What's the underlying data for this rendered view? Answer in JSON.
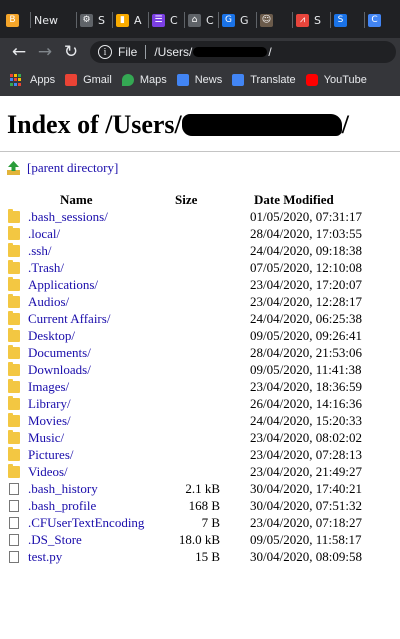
{
  "browser": {
    "tabs": [
      {
        "letter": "B",
        "label": "",
        "color": "#f4a52a"
      },
      {
        "letter": "",
        "label": "New",
        "color": "#202124"
      },
      {
        "letter": "⚙",
        "label": "S",
        "color": "#5f6368"
      },
      {
        "letter": "▮",
        "label": "A",
        "color": "#f9ab00"
      },
      {
        "letter": "☰",
        "label": "C",
        "color": "#7b3fe4"
      },
      {
        "letter": "⌂",
        "label": "C",
        "color": "#5f6368"
      },
      {
        "letter": "G",
        "label": "G",
        "color": "#1a73e8"
      },
      {
        "letter": "☺",
        "label": "",
        "color": "#6b5b4b"
      },
      {
        "letter": "⩘",
        "label": "S",
        "color": "#e8453c"
      },
      {
        "letter": "S",
        "label": "",
        "color": "#1a73e8"
      },
      {
        "letter": "C",
        "label": "",
        "color": "#4285f4"
      }
    ],
    "address": {
      "scheme": "File",
      "path_prefix": "/Users/",
      "path_suffix": "/"
    },
    "bookmarks": [
      {
        "label": "Apps",
        "icon": "apps-grid-icon"
      },
      {
        "label": "Gmail",
        "icon": "gmail-icon",
        "color": "#ea4335"
      },
      {
        "label": "Maps",
        "icon": "maps-icon",
        "color": "#34a853"
      },
      {
        "label": "News",
        "icon": "news-icon",
        "color": "#4285f4"
      },
      {
        "label": "Translate",
        "icon": "translate-icon",
        "color": "#4285f4"
      },
      {
        "label": "YouTube",
        "icon": "youtube-icon",
        "color": "#ff0000"
      }
    ]
  },
  "page": {
    "title_prefix": "Index of /Users/",
    "title_suffix": "/",
    "parent_link": "[parent directory]",
    "columns": {
      "name": "Name",
      "size": "Size",
      "date": "Date Modified"
    },
    "entries": [
      {
        "name": ".bash_sessions/",
        "size": "",
        "date": "01/05/2020, 07:31:17",
        "type": "folder"
      },
      {
        "name": ".local/",
        "size": "",
        "date": "28/04/2020, 17:03:55",
        "type": "folder"
      },
      {
        "name": ".ssh/",
        "size": "",
        "date": "24/04/2020, 09:18:38",
        "type": "folder"
      },
      {
        "name": ".Trash/",
        "size": "",
        "date": "07/05/2020, 12:10:08",
        "type": "folder"
      },
      {
        "name": "Applications/",
        "size": "",
        "date": "23/04/2020, 17:20:07",
        "type": "folder"
      },
      {
        "name": "Audios/",
        "size": "",
        "date": "23/04/2020, 12:28:17",
        "type": "folder"
      },
      {
        "name": "Current Affairs/",
        "size": "",
        "date": "24/04/2020, 06:25:38",
        "type": "folder"
      },
      {
        "name": "Desktop/",
        "size": "",
        "date": "09/05/2020, 09:26:41",
        "type": "folder"
      },
      {
        "name": "Documents/",
        "size": "",
        "date": "28/04/2020, 21:53:06",
        "type": "folder"
      },
      {
        "name": "Downloads/",
        "size": "",
        "date": "09/05/2020, 11:41:38",
        "type": "folder"
      },
      {
        "name": "Images/",
        "size": "",
        "date": "23/04/2020, 18:36:59",
        "type": "folder"
      },
      {
        "name": "Library/",
        "size": "",
        "date": "26/04/2020, 14:16:36",
        "type": "folder"
      },
      {
        "name": "Movies/",
        "size": "",
        "date": "24/04/2020, 15:20:33",
        "type": "folder"
      },
      {
        "name": "Music/",
        "size": "",
        "date": "23/04/2020, 08:02:02",
        "type": "folder"
      },
      {
        "name": "Pictures/",
        "size": "",
        "date": "23/04/2020, 07:28:13",
        "type": "folder"
      },
      {
        "name": "Videos/",
        "size": "",
        "date": "23/04/2020, 21:49:27",
        "type": "folder"
      },
      {
        "name": ".bash_history",
        "size": "2.1 kB",
        "date": "30/04/2020, 17:40:21",
        "type": "file"
      },
      {
        "name": ".bash_profile",
        "size": "168 B",
        "date": "30/04/2020, 07:51:32",
        "type": "file"
      },
      {
        "name": ".CFUserTextEncoding",
        "size": "7 B",
        "date": "23/04/2020, 07:18:27",
        "type": "file"
      },
      {
        "name": ".DS_Store",
        "size": "18.0 kB",
        "date": "09/05/2020, 11:58:17",
        "type": "file"
      },
      {
        "name": "test.py",
        "size": "15 B",
        "date": "30/04/2020, 08:09:58",
        "type": "file"
      }
    ]
  }
}
